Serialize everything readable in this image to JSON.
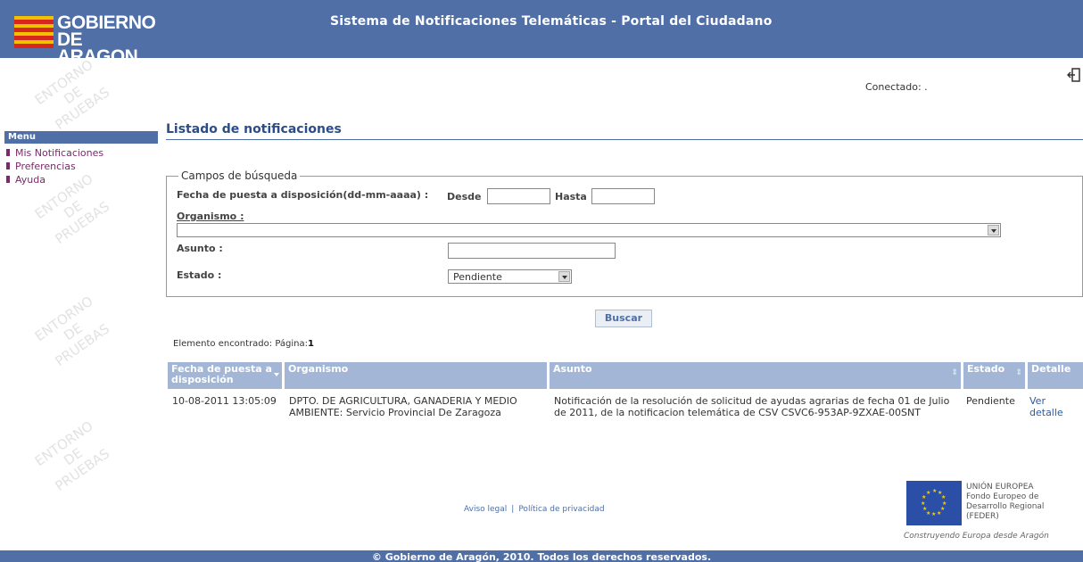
{
  "header": {
    "logo_line1": "GOBIERNO",
    "logo_line2": "DE ARAGON",
    "title": "Sistema de Notificaciones Telemáticas - Portal del Ciudadano"
  },
  "watermark": {
    "line1": "ENTORNO",
    "line2": "DE",
    "line3": "PRUEBAS"
  },
  "top": {
    "connected_label": "Conectado: .",
    "logout_icon": "logout-icon"
  },
  "menu": {
    "heading": "Menu",
    "items": [
      {
        "label": "Mis Notificaciones"
      },
      {
        "label": "Preferencias"
      },
      {
        "label": "Ayuda"
      }
    ]
  },
  "page_title": "Listado de notificaciones",
  "search": {
    "legend": "Campos de búsqueda",
    "date_label": "Fecha de puesta a disposición(dd-mm-aaaa) :",
    "from_label": "Desde",
    "from_value": "",
    "to_label": "Hasta",
    "to_value": "",
    "organismo_label": "Organismo :",
    "organismo_value": "",
    "asunto_label": "Asunto :",
    "asunto_value": "",
    "estado_label": "Estado :",
    "estado_value": "Pendiente",
    "button_label": "Buscar"
  },
  "results": {
    "found_label": "Elemento encontrado: Página:",
    "page": "1",
    "columns": [
      "Fecha de puesta a disposición",
      "Organismo",
      "Asunto",
      "Estado",
      "Detalle"
    ],
    "rows": [
      {
        "fecha": "10-08-2011 13:05:09",
        "organismo": "DPTO. DE AGRICULTURA, GANADERIA Y MEDIO AMBIENTE: Servicio Provincial De Zaragoza",
        "asunto": "Notificación de la resolución de solicitud de ayudas agrarias de fecha 01 de Julio de 2011, de la notificacion telemática de CSV CSVC6-953AP-9ZXAE-00SNT",
        "estado": "Pendiente",
        "detalle": "Ver detalle"
      }
    ]
  },
  "footer": {
    "legal": "Aviso legal",
    "separator": "|",
    "privacy": "Política de privacidad",
    "eu_line1": "UNIÓN EUROPEA",
    "eu_line2": "Fondo Europeo de",
    "eu_line3": "Desarrollo Regional",
    "eu_line4": "(FEDER)",
    "eu_tagline": "Construyendo Europa desde Aragón",
    "copyright": "© Gobierno de Aragón, 2010. Todos los derechos reservados.",
    "colors": {
      "brand": "#4f6fa6",
      "table_header": "#a3b6d6",
      "menu_text": "#7a2a6a"
    }
  }
}
